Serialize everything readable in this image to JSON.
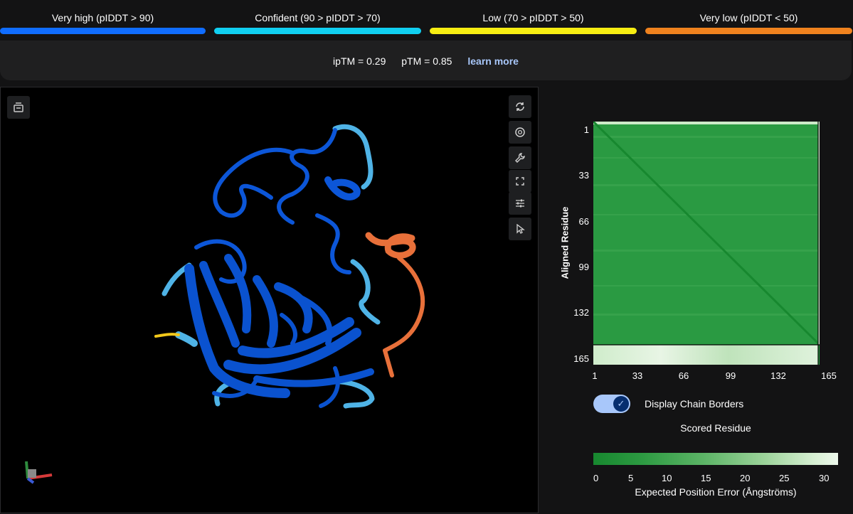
{
  "legend": [
    {
      "label": "Very high (pIDDT > 90)",
      "color": "#106dff"
    },
    {
      "label": "Confident (90 > pIDDT > 70)",
      "color": "#10cff1"
    },
    {
      "label": "Low (70 > pIDDT > 50)",
      "color": "#f6ed12"
    },
    {
      "label": "Very low (pIDDT < 50)",
      "color": "#ef821e"
    }
  ],
  "metrics": {
    "iptm": "ipTM = 0.29",
    "ptm": "pTM = 0.85",
    "learn_more": "learn more"
  },
  "viewer": {
    "toolbar_icons": [
      "sequence-icon"
    ],
    "side_icons": [
      "reset-icon",
      "camera-icon",
      "wrench-icon",
      "fullscreen-icon",
      "settings-icon",
      "select-icon"
    ]
  },
  "pae": {
    "y_label": "Aligned Residue",
    "x_label": "Scored Residue",
    "ticks": [
      "1",
      "33",
      "66",
      "99",
      "132",
      "165"
    ],
    "toggle_label": "Display Chain Borders",
    "scale_ticks": [
      "0",
      "5",
      "10",
      "15",
      "20",
      "25",
      "30"
    ],
    "scale_title": "Expected Position Error (Ångströms)"
  },
  "colors": {
    "pae_dark": "#17882f",
    "pae_light": "#eef8ec"
  }
}
